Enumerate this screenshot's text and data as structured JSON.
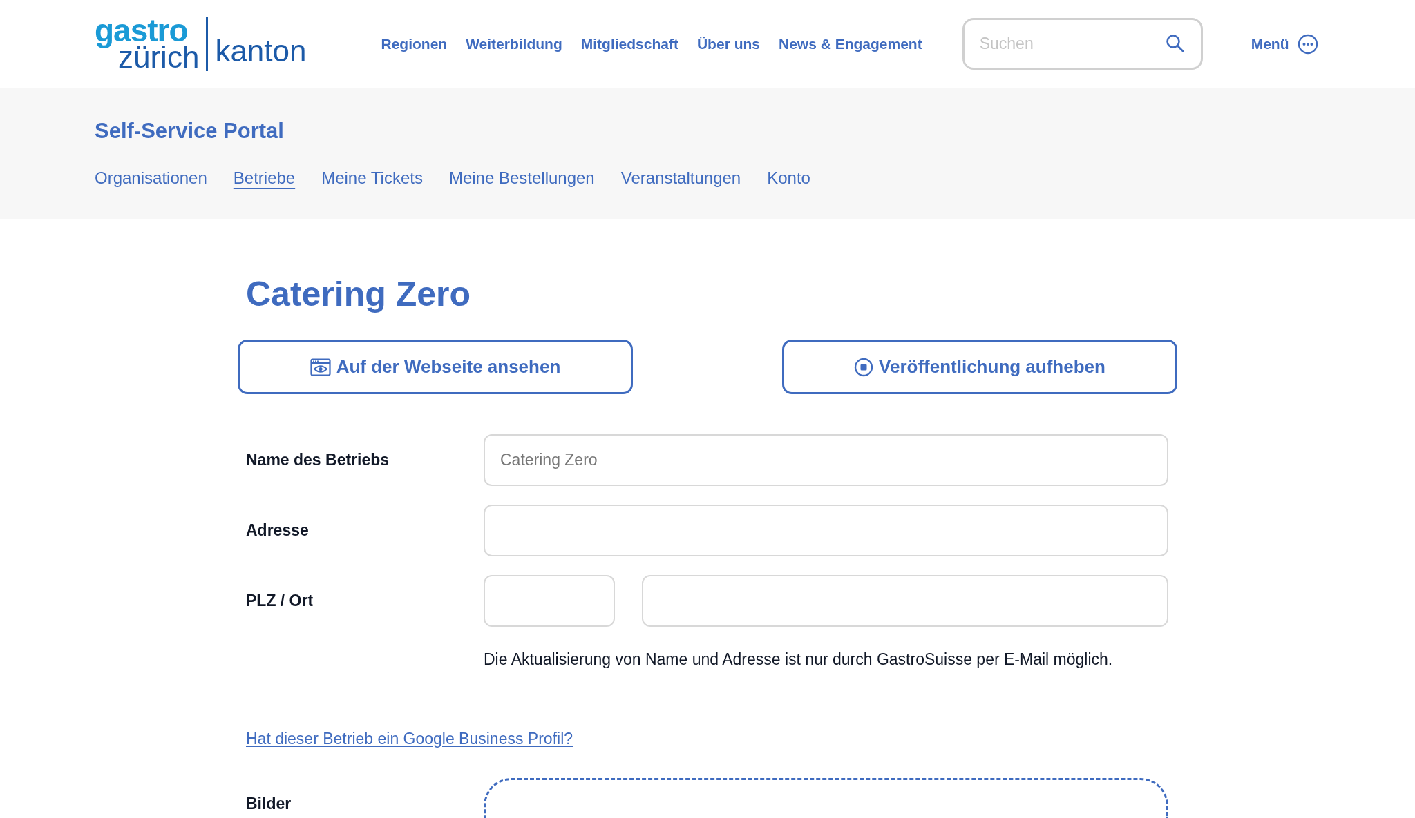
{
  "header": {
    "logo": {
      "word_1": "gastro",
      "word_2": "zürich",
      "word_3": "kanton"
    },
    "nav": [
      "Regionen",
      "Weiterbildung",
      "Mitgliedschaft",
      "Über uns",
      "News & Engagement"
    ],
    "search": {
      "placeholder": "Suchen"
    },
    "menu": "Menü"
  },
  "portal": {
    "title": "Self-Service Portal",
    "tabs": [
      {
        "label": "Organisationen",
        "selected": false
      },
      {
        "label": "Betriebe",
        "selected": true
      },
      {
        "label": "Meine Tickets",
        "selected": false
      },
      {
        "label": "Meine Bestellungen",
        "selected": false
      },
      {
        "label": "Veranstaltungen",
        "selected": false
      },
      {
        "label": "Konto",
        "selected": false
      }
    ]
  },
  "page_title": "Catering Zero",
  "buttons": [
    {
      "kind": "view",
      "label": "Auf der Webseite ansehen"
    },
    {
      "kind": "unpublish",
      "label": "Veröffentlichung aufheben"
    }
  ],
  "form": {
    "rows": [
      {
        "label": "Name des Betriebs",
        "inputs": [
          {
            "kind": "wide",
            "value": "Catering Zero"
          }
        ]
      },
      {
        "label": "Adresse",
        "inputs": [
          {
            "kind": "wide"
          }
        ]
      },
      {
        "label": "PLZ / Ort",
        "inputs": [
          {
            "kind": "short"
          },
          {
            "kind": "wide"
          }
        ]
      }
    ],
    "note": "Die Aktualisierung von Name und Adresse ist nur durch GastroSuisse per E-Mail möglich.",
    "google_link": "Hat dieser Betrieb ein Google Business Profil?",
    "images_label": "Bilder"
  }
}
